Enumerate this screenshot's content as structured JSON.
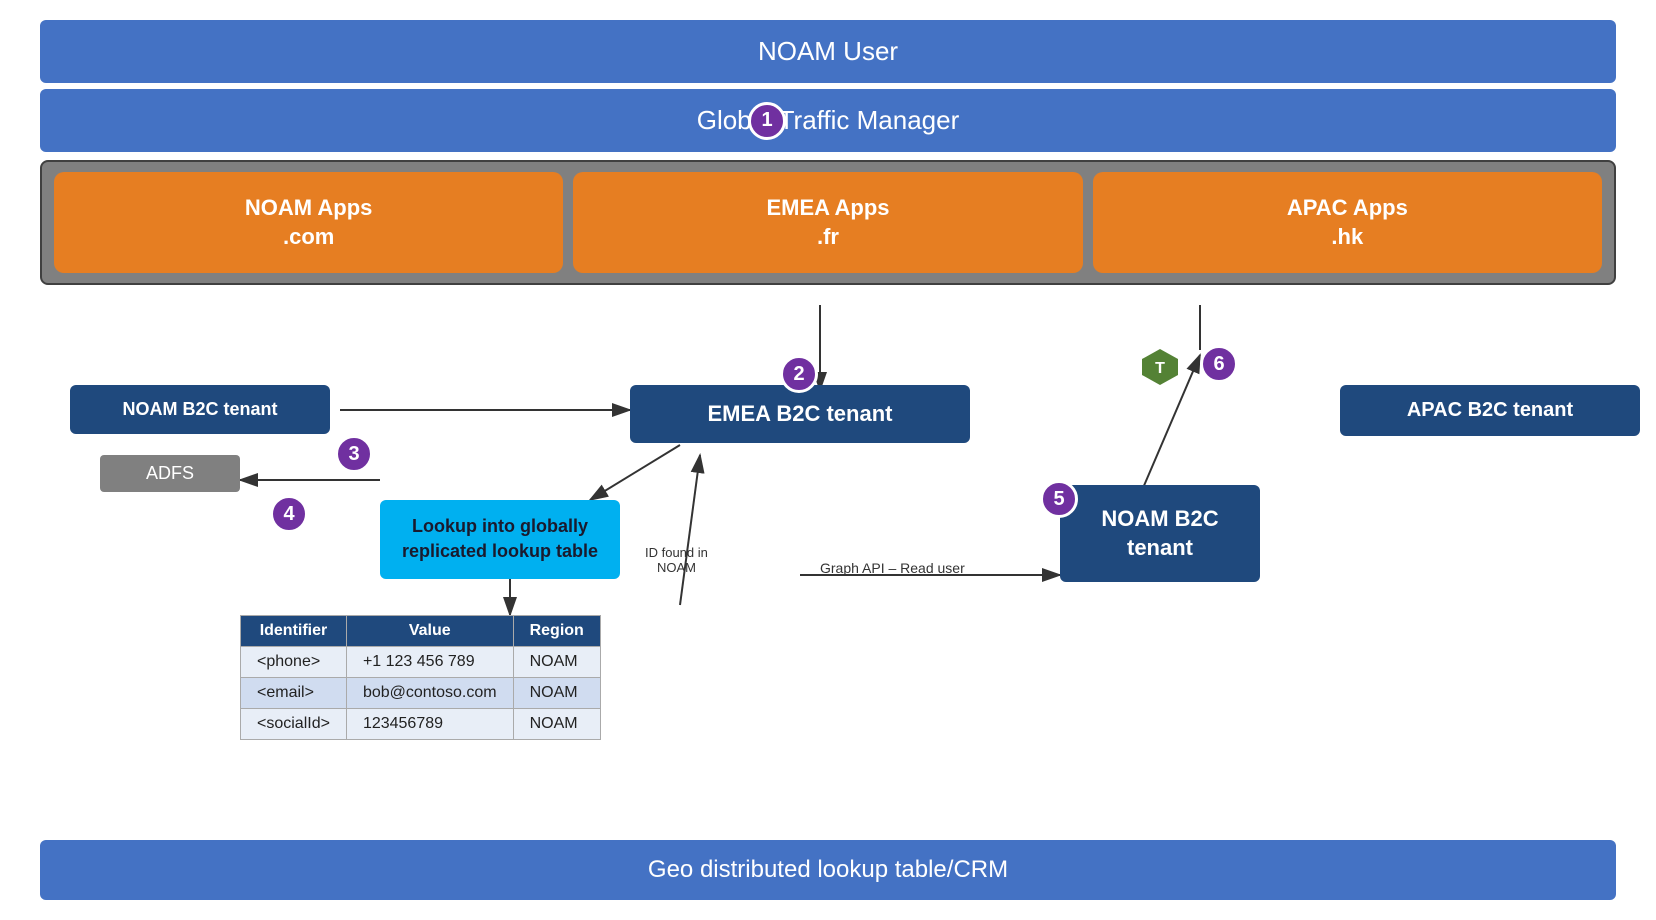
{
  "noam_user": "NOAM User",
  "gtm": "Global Traffic Manager",
  "apps": {
    "noam": {
      "line1": "NOAM Apps",
      "line2": ".com"
    },
    "emea": {
      "line1": "EMEA Apps",
      "line2": ".fr"
    },
    "apac": {
      "line1": "APAC Apps",
      "line2": ".hk"
    }
  },
  "tenants": {
    "noam": "NOAM B2C tenant",
    "emea": "EMEA B2C tenant",
    "noam2": {
      "line1": "NOAM B2C",
      "line2": "tenant"
    },
    "apac": "APAC B2C tenant"
  },
  "adfs": "ADFS",
  "lookup_box": {
    "line1": "Lookup into globally",
    "line2": "replicated lookup table"
  },
  "table": {
    "headers": [
      "Identifier",
      "Value",
      "Region"
    ],
    "rows": [
      [
        "<phone>",
        "+1 123 456 789",
        "NOAM"
      ],
      [
        "<email>",
        "bob@contoso.com",
        "NOAM"
      ],
      [
        "<socialId>",
        "123456789",
        "NOAM"
      ]
    ]
  },
  "labels": {
    "id_found": "ID found in\nNOAM",
    "graph_api": "Graph API – Read user"
  },
  "bottom_bar": "Geo distributed lookup table/CRM",
  "badges": [
    "1",
    "2",
    "3",
    "4",
    "5",
    "6"
  ],
  "token_label": "T",
  "colors": {
    "blue": "#4472C4",
    "dark_blue": "#1F497D",
    "orange": "#E67E22",
    "purple": "#7030A0",
    "teal": "#00B0F0",
    "green": "#548235",
    "gray": "#808080"
  }
}
